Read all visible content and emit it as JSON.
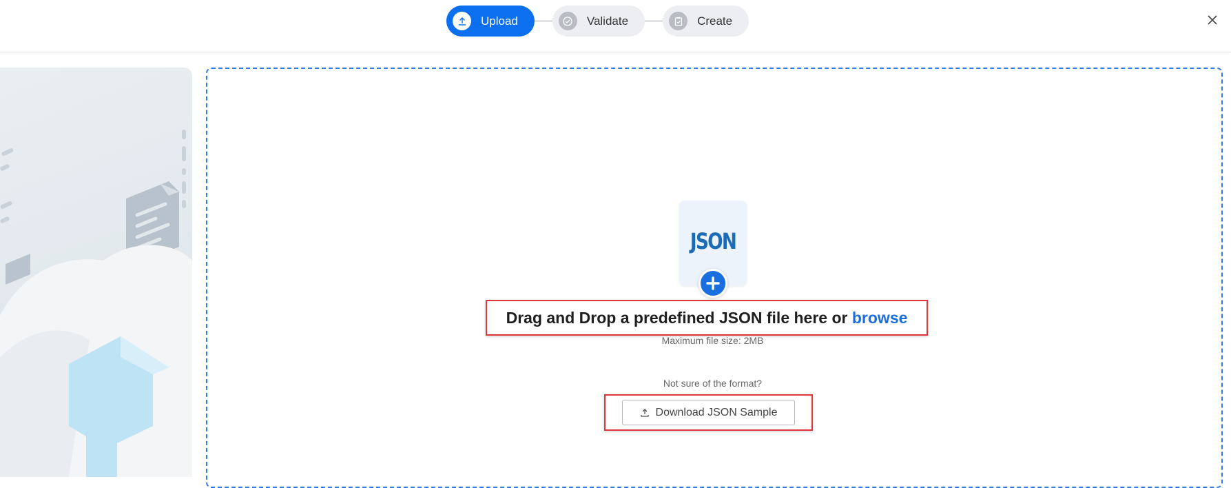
{
  "stepper": {
    "steps": [
      {
        "label": "Upload",
        "state": "active"
      },
      {
        "label": "Validate",
        "state": "pending"
      },
      {
        "label": "Create",
        "state": "pending"
      }
    ]
  },
  "dropzone": {
    "file_badge": "JSON",
    "headline_prefix": "Drag and Drop a predefined JSON file here or ",
    "browse_label": "browse",
    "max_size": "Maximum file size: 2MB",
    "format_hint": "Not sure of the format?",
    "download_label": "Download JSON Sample"
  },
  "colors": {
    "accent": "#0b6ff0",
    "dropzone_border": "#2f7be6",
    "highlight_border": "#e0353a"
  },
  "icons": [
    "upload-icon",
    "check-circle-icon",
    "clipboard-icon",
    "close-icon",
    "plus-icon",
    "download-icon"
  ]
}
